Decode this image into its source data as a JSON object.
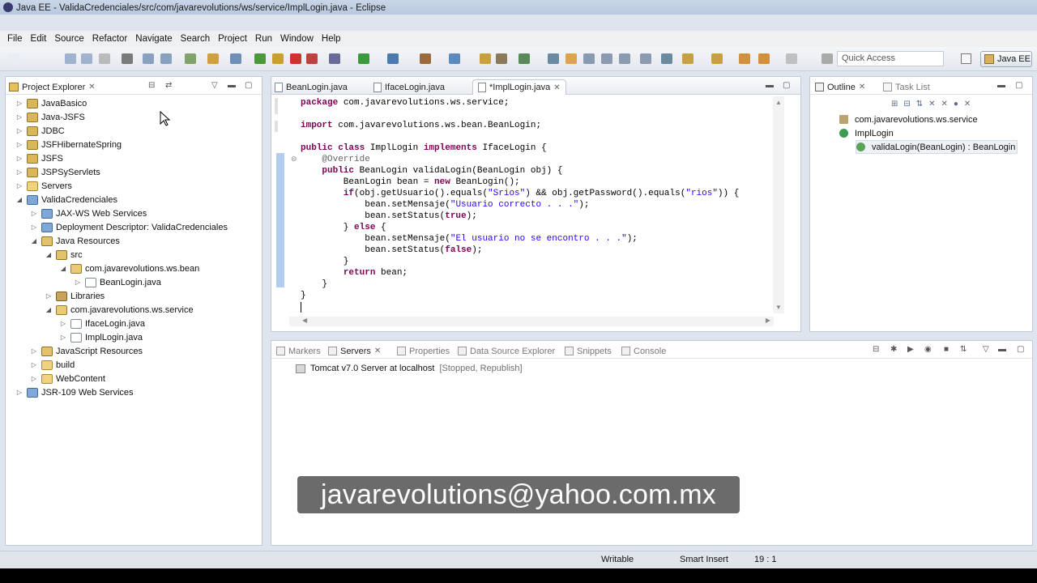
{
  "window": {
    "title": "Java EE - ValidaCredenciales/src/com/javarevolutions/ws/service/ImplLogin.java - Eclipse"
  },
  "menu": [
    "File",
    "Edit",
    "Source",
    "Refactor",
    "Navigate",
    "Search",
    "Project",
    "Run",
    "Window",
    "Help"
  ],
  "toolbar": {
    "quick_access_placeholder": "Quick Access",
    "perspective_label": "Java EE"
  },
  "project_explorer": {
    "title": "Project Explorer",
    "items": [
      {
        "label": "JavaBasico",
        "depth": 0,
        "expanded": false,
        "icon": "project-icon"
      },
      {
        "label": "Java-JSFS",
        "depth": 0,
        "expanded": false,
        "icon": "project-icon"
      },
      {
        "label": "JDBC",
        "depth": 0,
        "expanded": false,
        "icon": "project-icon"
      },
      {
        "label": "JSFHibernateSpring",
        "depth": 0,
        "expanded": false,
        "icon": "project-icon"
      },
      {
        "label": "JSFS",
        "depth": 0,
        "expanded": false,
        "icon": "project-icon"
      },
      {
        "label": "JSPSyServlets",
        "depth": 0,
        "expanded": false,
        "icon": "project-icon"
      },
      {
        "label": "Servers",
        "depth": 0,
        "expanded": false,
        "icon": "folder-icon"
      },
      {
        "label": "ValidaCredenciales",
        "depth": 0,
        "expanded": true,
        "icon": "web-project-icon"
      },
      {
        "label": "JAX-WS Web Services",
        "depth": 1,
        "expanded": false,
        "icon": "webservice-icon"
      },
      {
        "label": "Deployment Descriptor: ValidaCredenciales",
        "depth": 1,
        "expanded": false,
        "icon": "descriptor-icon"
      },
      {
        "label": "Java Resources",
        "depth": 1,
        "expanded": true,
        "icon": "java-resources-icon"
      },
      {
        "label": "src",
        "depth": 2,
        "expanded": true,
        "icon": "source-folder-icon"
      },
      {
        "label": "com.javarevolutions.ws.bean",
        "depth": 3,
        "expanded": true,
        "icon": "package-icon"
      },
      {
        "label": "BeanLogin.java",
        "depth": 4,
        "expanded": false,
        "icon": "java-file-icon"
      },
      {
        "label": "Libraries",
        "depth": 2,
        "expanded": false,
        "icon": "library-icon"
      },
      {
        "label": "com.javarevolutions.ws.service",
        "depth": 2,
        "expanded": true,
        "icon": "package-icon"
      },
      {
        "label": "IfaceLogin.java",
        "depth": 3,
        "expanded": false,
        "icon": "java-file-icon"
      },
      {
        "label": "ImplLogin.java",
        "depth": 3,
        "expanded": false,
        "icon": "java-file-icon"
      },
      {
        "label": "JavaScript Resources",
        "depth": 1,
        "expanded": false,
        "icon": "js-resources-icon"
      },
      {
        "label": "build",
        "depth": 1,
        "expanded": false,
        "icon": "folder-icon"
      },
      {
        "label": "WebContent",
        "depth": 1,
        "expanded": false,
        "icon": "folder-icon"
      },
      {
        "label": "JSR-109 Web Services",
        "depth": 0,
        "expanded": false,
        "icon": "webservice-icon"
      }
    ]
  },
  "editor": {
    "tabs": [
      "BeanLogin.java",
      "IfaceLogin.java",
      "*ImplLogin.java"
    ],
    "active_tab": 2,
    "lines": [
      [
        {
          "t": "package ",
          "c": "kw"
        },
        {
          "t": "com.javarevolutions.ws.service;",
          "c": ""
        }
      ],
      [],
      [
        {
          "t": "import ",
          "c": "kw"
        },
        {
          "t": "com.javarevolutions.ws.bean.BeanLogin;",
          "c": ""
        }
      ],
      [],
      [
        {
          "t": "public class ",
          "c": "kw"
        },
        {
          "t": "ImplLogin ",
          "c": ""
        },
        {
          "t": "implements ",
          "c": "kw"
        },
        {
          "t": "IfaceLogin {",
          "c": ""
        }
      ],
      [
        {
          "t": "    @Override",
          "c": "ann"
        }
      ],
      [
        {
          "t": "    ",
          "c": ""
        },
        {
          "t": "public ",
          "c": "kw"
        },
        {
          "t": "BeanLogin validaLogin(BeanLogin obj) {",
          "c": ""
        }
      ],
      [
        {
          "t": "        BeanLogin bean = ",
          "c": ""
        },
        {
          "t": "new ",
          "c": "kw"
        },
        {
          "t": "BeanLogin();",
          "c": ""
        }
      ],
      [
        {
          "t": "        ",
          "c": ""
        },
        {
          "t": "if",
          "c": "kw"
        },
        {
          "t": "(obj.getUsuario().equals(",
          "c": ""
        },
        {
          "t": "\"Srios\"",
          "c": "str"
        },
        {
          "t": ") && obj.getPassword().equals(",
          "c": ""
        },
        {
          "t": "\"rios\"",
          "c": "str"
        },
        {
          "t": ")) {",
          "c": ""
        }
      ],
      [
        {
          "t": "            bean.setMensaje(",
          "c": ""
        },
        {
          "t": "\"Usuario correcto . . .\"",
          "c": "str"
        },
        {
          "t": ");",
          "c": ""
        }
      ],
      [
        {
          "t": "            bean.setStatus(",
          "c": ""
        },
        {
          "t": "true",
          "c": "kw"
        },
        {
          "t": ");",
          "c": ""
        }
      ],
      [
        {
          "t": "        } ",
          "c": ""
        },
        {
          "t": "else ",
          "c": "kw"
        },
        {
          "t": "{",
          "c": ""
        }
      ],
      [
        {
          "t": "            bean.setMensaje(",
          "c": ""
        },
        {
          "t": "\"El usuario no se encontro . . .\"",
          "c": "str"
        },
        {
          "t": ");",
          "c": ""
        }
      ],
      [
        {
          "t": "            bean.setStatus(",
          "c": ""
        },
        {
          "t": "false",
          "c": "kw"
        },
        {
          "t": ");",
          "c": ""
        }
      ],
      [
        {
          "t": "        }",
          "c": ""
        }
      ],
      [
        {
          "t": "        ",
          "c": ""
        },
        {
          "t": "return ",
          "c": "kw"
        },
        {
          "t": "bean;",
          "c": ""
        }
      ],
      [
        {
          "t": "    }",
          "c": ""
        }
      ],
      [
        {
          "t": "}",
          "c": ""
        }
      ],
      []
    ]
  },
  "outline": {
    "tabs": [
      "Outline",
      "Task List"
    ],
    "items": [
      {
        "label": "com.javarevolutions.ws.service",
        "depth": 0
      },
      {
        "label": "ImplLogin",
        "depth": 0
      },
      {
        "label": "validaLogin(BeanLogin) : BeanLogin",
        "depth": 1
      }
    ]
  },
  "bottom_panel": {
    "tabs": [
      "Markers",
      "Servers",
      "Properties",
      "Data Source Explorer",
      "Snippets",
      "Console"
    ],
    "active_tab": 1,
    "server_name": "Tomcat v7.0 Server at localhost",
    "server_state": "[Stopped, Republish]"
  },
  "status_bar": {
    "mode": "Writable",
    "insert": "Smart Insert",
    "position": "19 : 1"
  },
  "overlay_text": "javarevolutions@yahoo.com.mx",
  "colors": {
    "keyword": "#7f0055",
    "string": "#2a00ff",
    "annotation": "#646464"
  }
}
